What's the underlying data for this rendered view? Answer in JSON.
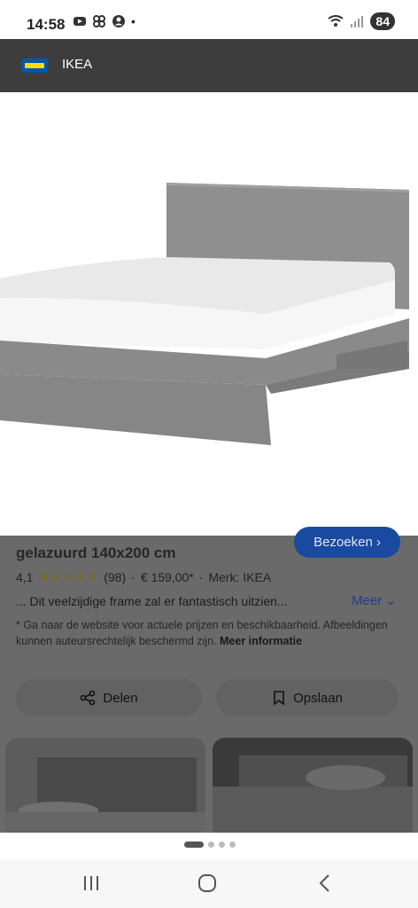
{
  "status": {
    "time": "14:58",
    "dot": "•",
    "battery": "84"
  },
  "app": {
    "title": "IKEA",
    "logo": "ikea-logo"
  },
  "product": {
    "title_line2": "gelazuurd 140x200 cm",
    "visit_label": "Bezoeken",
    "rating": "4,1",
    "stars": "★★★★★",
    "reviews": "(98)",
    "separator": "·",
    "price": "€ 159,00*",
    "brand": "Merk: IKEA",
    "description": "... Dit veelzijdige frame zal er fantastisch uitzien...",
    "more_label": "Meer",
    "disclaimer": "* Ga naar de website voor actuele prijzen en beschikbaarheid. Afbeeldingen kunnen auteursrechtelijk beschermd zijn.",
    "more_info": "Meer informatie"
  },
  "actions": {
    "share": "Delen",
    "save": "Opslaan"
  },
  "pager": {
    "count": 4,
    "active": 1
  },
  "colors": {
    "accent": "#1a4aa0",
    "frame": "#8e8e8e"
  }
}
